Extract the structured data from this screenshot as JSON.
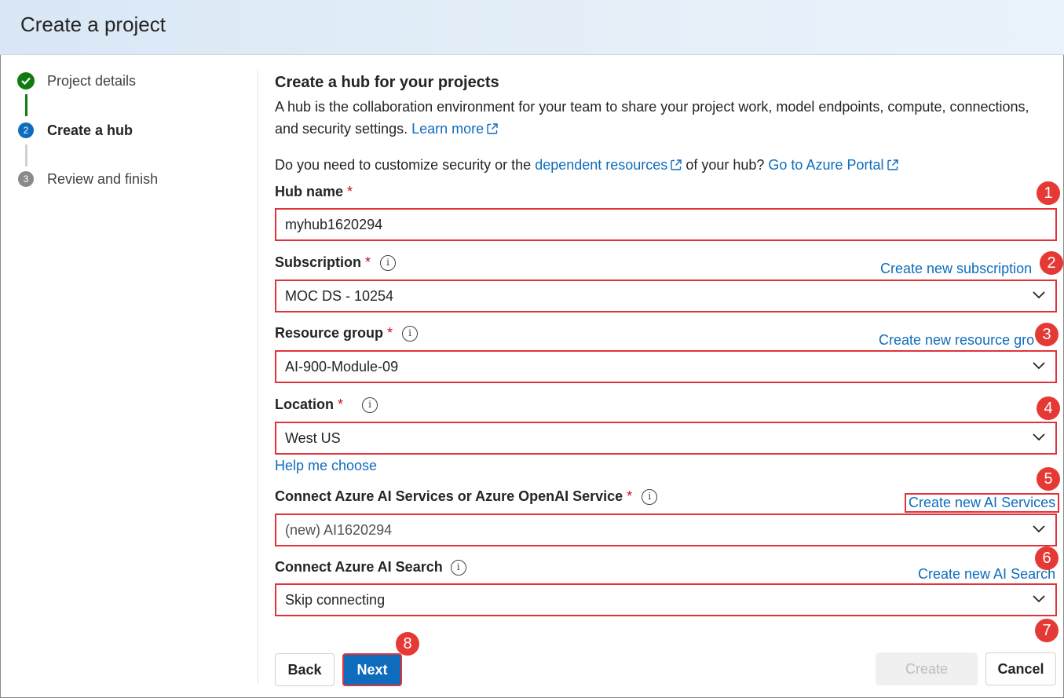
{
  "header": {
    "title": "Create a project"
  },
  "steps": [
    {
      "number": "1",
      "label": "Project details",
      "state": "done"
    },
    {
      "number": "2",
      "label": "Create a hub",
      "state": "active"
    },
    {
      "number": "3",
      "label": "Review and finish",
      "state": "todo"
    }
  ],
  "main": {
    "title": "Create a hub for your projects",
    "description": "A hub is the collaboration environment for your team to share your project work, model endpoints, compute, connections, and security settings.",
    "learn_more": "Learn more",
    "customize_prefix": "Do you need to customize security or the",
    "dependent_resources": "dependent resources",
    "customize_middle": "of your hub?",
    "go_to_portal": "Go to Azure Portal"
  },
  "form": {
    "hub_name": {
      "label": "Hub name",
      "value": "myhub1620294"
    },
    "subscription": {
      "label": "Subscription",
      "value": "MOC DS - 10254",
      "create_link": "Create new subscription"
    },
    "resource_group": {
      "label": "Resource group",
      "value": "AI-900-Module-09",
      "create_link": "Create new resource gro"
    },
    "location": {
      "label": "Location",
      "value": "West US",
      "help_link": "Help me choose"
    },
    "ai_services": {
      "label": "Connect Azure AI Services or Azure OpenAI Service",
      "value": "(new) AI1620294",
      "create_link": "Create new AI Services"
    },
    "ai_search": {
      "label": "Connect Azure AI Search",
      "value": "Skip connecting",
      "create_link": "Create new AI Search"
    },
    "required_mark": "*",
    "info_glyph": "i"
  },
  "buttons": {
    "back": "Back",
    "next": "Next",
    "create": "Create",
    "cancel": "Cancel"
  },
  "badges": [
    "1",
    "2",
    "3",
    "4",
    "5",
    "6",
    "7",
    "8"
  ],
  "colors": {
    "accent": "#0f6cbd",
    "success": "#107c10",
    "highlight": "#e0343a",
    "badge": "#e53935"
  }
}
